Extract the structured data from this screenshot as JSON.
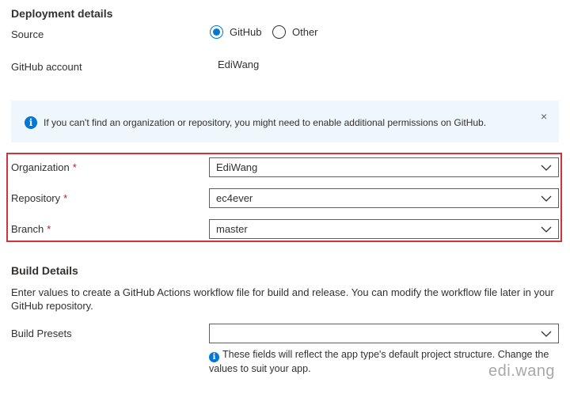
{
  "deployment": {
    "title": "Deployment details",
    "source_label": "Source",
    "source_options": [
      {
        "label": "GitHub",
        "checked": true
      },
      {
        "label": "Other",
        "checked": false
      }
    ],
    "account_label": "GitHub account",
    "account_value": "EdiWang"
  },
  "infobar": {
    "icon": "info-icon",
    "message": "If you can't find an organization or repository, you might need to enable additional permissions on GitHub.",
    "close": "×"
  },
  "repo": {
    "organization_label": "Organization",
    "organization_value": "EdiWang",
    "repository_label": "Repository",
    "repository_value": "ec4ever",
    "branch_label": "Branch",
    "branch_value": "master",
    "required_mark": "*",
    "highlight_color": "#d13438"
  },
  "build": {
    "title": "Build Details",
    "description": "Enter values to create a GitHub Actions workflow file for build and release. You can modify the workflow file later in your GitHub repository.",
    "presets_label": "Build Presets",
    "presets_value": "",
    "hint": "These fields will reflect the app type's default project structure. Change the values to suit your app."
  },
  "watermark": "edi.wang",
  "colors": {
    "accent": "#0078d4",
    "info_background": "#eff6fc",
    "required": "#a4262c"
  }
}
